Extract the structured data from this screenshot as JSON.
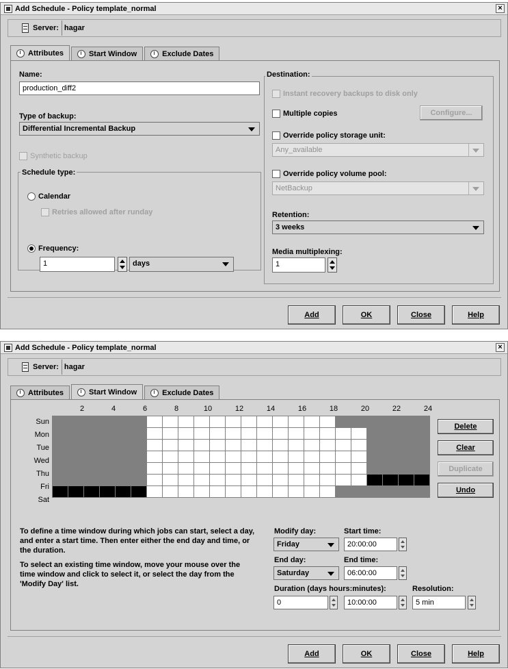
{
  "dialog1": {
    "title": "Add Schedule - Policy template_normal",
    "server_label": "Server:",
    "server_value": "hagar",
    "tabs": [
      "Attributes",
      "Start Window",
      "Exclude Dates"
    ],
    "active_tab": "Attributes",
    "name_label": "Name:",
    "name_value": "production_diff2",
    "type_label": "Type of backup:",
    "type_value": "Differential Incremental Backup",
    "synthetic_label": "Synthetic backup",
    "schedule_type_label": "Schedule type:",
    "calendar_label": "Calendar",
    "retries_label": "Retries allowed after runday",
    "frequency_label": "Frequency:",
    "frequency_value": "1",
    "frequency_unit": "days",
    "destination_label": "Destination:",
    "instant_recovery_label": "Instant recovery backups to disk only",
    "multiple_copies_label": "Multiple copies",
    "configure_button": "Configure...",
    "override_storage_label": "Override policy storage unit:",
    "storage_value": "Any_available",
    "override_pool_label": "Override policy volume pool:",
    "pool_value": "NetBackup",
    "retention_label": "Retention:",
    "retention_value": "3 weeks",
    "multiplexing_label": "Media multiplexing:",
    "multiplexing_value": "1"
  },
  "dialog2": {
    "title": "Add Schedule - Policy template_normal",
    "server_label": "Server:",
    "server_value": "hagar",
    "tabs": [
      "Attributes",
      "Start Window",
      "Exclude Dates"
    ],
    "active_tab": "Start Window",
    "hour_labels": [
      "2",
      "4",
      "6",
      "8",
      "10",
      "12",
      "14",
      "16",
      "18",
      "20",
      "22",
      "24"
    ],
    "days": [
      "Sun",
      "Mon",
      "Tue",
      "Wed",
      "Thu",
      "Fri",
      "Sat"
    ],
    "schedule_grid": [
      [
        1,
        1,
        1,
        1,
        1,
        1,
        0,
        0,
        0,
        0,
        0,
        0,
        0,
        0,
        0,
        0,
        0,
        0,
        1,
        1,
        1,
        1,
        1,
        1
      ],
      [
        1,
        1,
        1,
        1,
        1,
        1,
        0,
        0,
        0,
        0,
        0,
        0,
        0,
        0,
        0,
        0,
        0,
        0,
        0,
        0,
        1,
        1,
        1,
        1
      ],
      [
        1,
        1,
        1,
        1,
        1,
        1,
        0,
        0,
        0,
        0,
        0,
        0,
        0,
        0,
        0,
        0,
        0,
        0,
        0,
        0,
        1,
        1,
        1,
        1
      ],
      [
        1,
        1,
        1,
        1,
        1,
        1,
        0,
        0,
        0,
        0,
        0,
        0,
        0,
        0,
        0,
        0,
        0,
        0,
        0,
        0,
        1,
        1,
        1,
        1
      ],
      [
        1,
        1,
        1,
        1,
        1,
        1,
        0,
        0,
        0,
        0,
        0,
        0,
        0,
        0,
        0,
        0,
        0,
        0,
        0,
        0,
        1,
        1,
        1,
        1
      ],
      [
        1,
        1,
        1,
        1,
        1,
        1,
        0,
        0,
        0,
        0,
        0,
        0,
        0,
        0,
        0,
        0,
        0,
        0,
        0,
        0,
        2,
        2,
        2,
        2
      ],
      [
        2,
        2,
        2,
        2,
        2,
        2,
        0,
        0,
        0,
        0,
        0,
        0,
        0,
        0,
        0,
        0,
        0,
        0,
        1,
        1,
        1,
        1,
        1,
        1
      ]
    ],
    "buttons_side": {
      "delete": "Delete",
      "clear": "Clear",
      "duplicate": "Duplicate",
      "undo": "Undo"
    },
    "info_text_1": "To define a time window during which jobs can start, select a day, and enter a start time. Then enter either the end day and time, or the duration.",
    "info_text_2": "To select an existing time window, move your mouse over the time window and click to select it, or select the day from the 'Modify Day' list.",
    "modify_day_label": "Modify day:",
    "modify_day_value": "Friday",
    "start_time_label": "Start time:",
    "start_time_value": "20:00:00",
    "end_day_label": "End day:",
    "end_day_value": "Saturday",
    "end_time_label": "End time:",
    "end_time_value": "06:00:00",
    "duration_label": "Duration (days hours:minutes):",
    "duration_days_value": "0",
    "duration_time_value": "10:00:00",
    "resolution_label": "Resolution:",
    "resolution_value": "5 min"
  },
  "footer_buttons": {
    "add": "Add",
    "ok": "OK",
    "close": "Close",
    "help": "Help"
  }
}
